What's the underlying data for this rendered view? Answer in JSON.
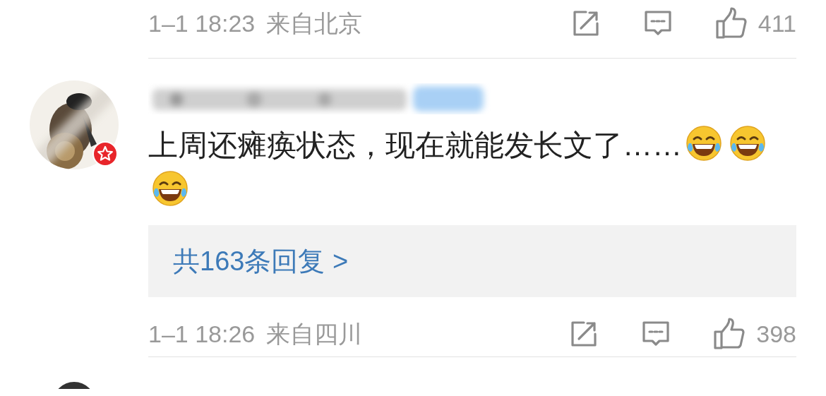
{
  "previous_comment_footer": {
    "time": "1–1 18:23",
    "location": "来自北京",
    "likes": "411"
  },
  "comment": {
    "badge": {
      "kind": "verified"
    },
    "content": [
      {
        "kind": "text",
        "text": "上周还瘫痪状态，现在就能发长文了……"
      },
      {
        "kind": "emoji"
      },
      {
        "kind": "emoji"
      },
      {
        "kind": "emoji"
      }
    ],
    "replies_link": "共163条回复 >",
    "footer": {
      "time": "1–1 18:26",
      "location": "来自四川",
      "likes": "398"
    }
  }
}
